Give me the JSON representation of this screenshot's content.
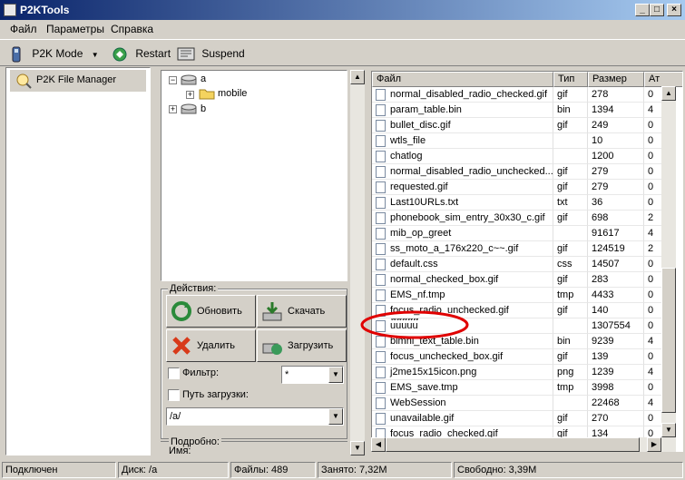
{
  "window": {
    "title": "P2KTools"
  },
  "menu": [
    "Файл",
    "Параметры",
    "Справка"
  ],
  "toolbar": {
    "mode": "P2K Mode",
    "restart": "Restart",
    "suspend": "Suspend"
  },
  "left_panel": {
    "item": "P2K File Manager"
  },
  "tree": {
    "nodes": [
      {
        "label": "a"
      },
      {
        "label": "mobile"
      },
      {
        "label": "b"
      }
    ]
  },
  "actions": {
    "group_label": "Действия:",
    "refresh": "Обновить",
    "download": "Скачать",
    "delete": "Удалить",
    "upload": "Загрузить",
    "filter_label": "Фильтр:",
    "filter_value": "*",
    "path_label": "Путь загрузки:",
    "path_value": "/a/",
    "details_label": "Подробно:",
    "name_label": "Имя:"
  },
  "file_table": {
    "columns": [
      "Файл",
      "Тип",
      "Размер",
      "Ат"
    ],
    "rows": [
      {
        "name": "normal_disabled_radio_checked.gif",
        "type": "gif",
        "size": "278",
        "attr": "0"
      },
      {
        "name": "param_table.bin",
        "type": "bin",
        "size": "1394",
        "attr": "4"
      },
      {
        "name": "bullet_disc.gif",
        "type": "gif",
        "size": "249",
        "attr": "0"
      },
      {
        "name": "wtls_file",
        "type": "",
        "size": "10",
        "attr": "0"
      },
      {
        "name": "chatlog",
        "type": "",
        "size": "1200",
        "attr": "0"
      },
      {
        "name": "normal_disabled_radio_unchecked...",
        "type": "gif",
        "size": "279",
        "attr": "0"
      },
      {
        "name": "requested.gif",
        "type": "gif",
        "size": "279",
        "attr": "0"
      },
      {
        "name": "Last10URLs.txt",
        "type": "txt",
        "size": "36",
        "attr": "0"
      },
      {
        "name": "phonebook_sim_entry_30x30_c.gif",
        "type": "gif",
        "size": "698",
        "attr": "2"
      },
      {
        "name": "mib_op_greet",
        "type": "",
        "size": "91617",
        "attr": "4"
      },
      {
        "name": "ss_moto_a_176x220_c~~.gif",
        "type": "gif",
        "size": "124519",
        "attr": "2"
      },
      {
        "name": "default.css",
        "type": "css",
        "size": "14507",
        "attr": "0"
      },
      {
        "name": "normal_checked_box.gif",
        "type": "gif",
        "size": "283",
        "attr": "0"
      },
      {
        "name": "EMS_nf.tmp",
        "type": "tmp",
        "size": "4433",
        "attr": "0"
      },
      {
        "name": "focus_radio_unchecked.gif",
        "type": "gif",
        "size": "140",
        "attr": "0"
      },
      {
        "name": "u๊u๊u๊u๊u๊",
        "type": "",
        "size": "1307554",
        "attr": "0"
      },
      {
        "name": "blmnl_text_table.bin",
        "type": "bin",
        "size": "9239",
        "attr": "4"
      },
      {
        "name": "focus_unchecked_box.gif",
        "type": "gif",
        "size": "139",
        "attr": "0"
      },
      {
        "name": "j2me15x15icon.png",
        "type": "png",
        "size": "1239",
        "attr": "4"
      },
      {
        "name": "EMS_save.tmp",
        "type": "tmp",
        "size": "3998",
        "attr": "0"
      },
      {
        "name": "WebSession",
        "type": "",
        "size": "22468",
        "attr": "4"
      },
      {
        "name": "unavailable.gif",
        "type": "gif",
        "size": "270",
        "attr": "0"
      },
      {
        "name": "focus_radio_checked.gif",
        "type": "gif",
        "size": "134",
        "attr": "0"
      }
    ]
  },
  "status": {
    "connection": "Подключен",
    "disk": "Диск: /a",
    "files": "Файлы: 489",
    "used": "Занято: 7,32M",
    "free": "Свободно: 3,39M"
  },
  "colors": {
    "title_start": "#0a246a",
    "title_end": "#a6caf0",
    "highlight_ellipse": "#e00000"
  },
  "icons": [
    "app-icon",
    "phone-icon",
    "restart-icon",
    "suspend-icon",
    "folder-icon",
    "drive-icon",
    "refresh-icon",
    "download-icon",
    "delete-icon",
    "upload-icon",
    "file-icon"
  ]
}
